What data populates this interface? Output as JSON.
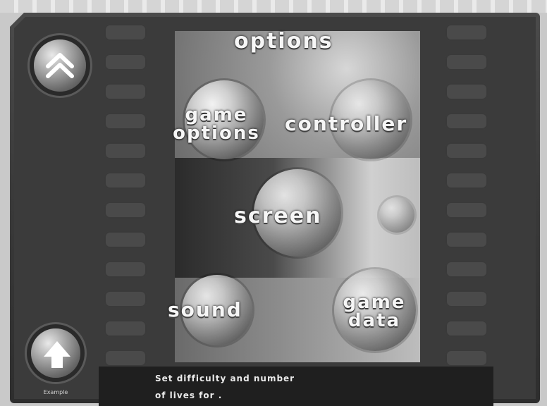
{
  "menu": {
    "title": "options",
    "items": [
      {
        "id": "game-options",
        "lines": [
          "game",
          "options"
        ]
      },
      {
        "id": "controller",
        "lines": [
          "controller"
        ]
      },
      {
        "id": "screen",
        "lines": [
          "screen"
        ]
      },
      {
        "id": "sound",
        "lines": [
          "sound"
        ]
      },
      {
        "id": "game-data",
        "lines": [
          "game",
          "data"
        ]
      }
    ]
  },
  "nav": {
    "top_button_caption": "",
    "bottom_button_caption": "Example"
  },
  "help": {
    "tag": "",
    "line1": "Set difficulty and number",
    "line2_prefix": "of lives for ",
    "line2_highlight": "",
    "line2_suffix": "."
  },
  "icons": {
    "top_button": "double-chevron-up-icon",
    "bottom_button": "up-arrow-icon"
  },
  "colors": {
    "label_text": "#f6f6f6",
    "frame": "#3b3b3b",
    "help_bar": "#1f1f1f"
  }
}
